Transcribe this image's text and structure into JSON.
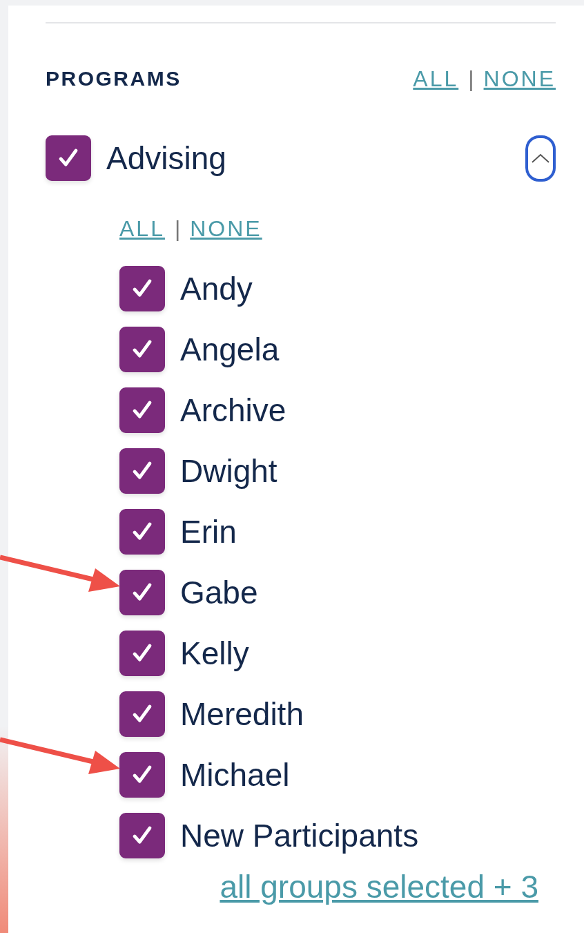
{
  "programs": {
    "title": "PROGRAMS",
    "all_link": "ALL",
    "separator": "|",
    "none_link": "NONE",
    "groups": [
      {
        "label": "Advising",
        "checked": true,
        "expanded": true,
        "all_link": "ALL",
        "separator": "|",
        "none_link": "NONE",
        "items": [
          {
            "label": "Andy",
            "checked": true,
            "arrow": false
          },
          {
            "label": "Angela",
            "checked": true,
            "arrow": false
          },
          {
            "label": "Archive",
            "checked": true,
            "arrow": false
          },
          {
            "label": "Dwight",
            "checked": true,
            "arrow": false
          },
          {
            "label": "Erin",
            "checked": true,
            "arrow": false
          },
          {
            "label": "Gabe",
            "checked": true,
            "arrow": true
          },
          {
            "label": "Kelly",
            "checked": true,
            "arrow": false
          },
          {
            "label": "Meredith",
            "checked": true,
            "arrow": false
          },
          {
            "label": "Michael",
            "checked": true,
            "arrow": true
          },
          {
            "label": "New Participants",
            "checked": true,
            "arrow": false
          }
        ]
      }
    ],
    "summary_link": "all groups selected + 3"
  }
}
